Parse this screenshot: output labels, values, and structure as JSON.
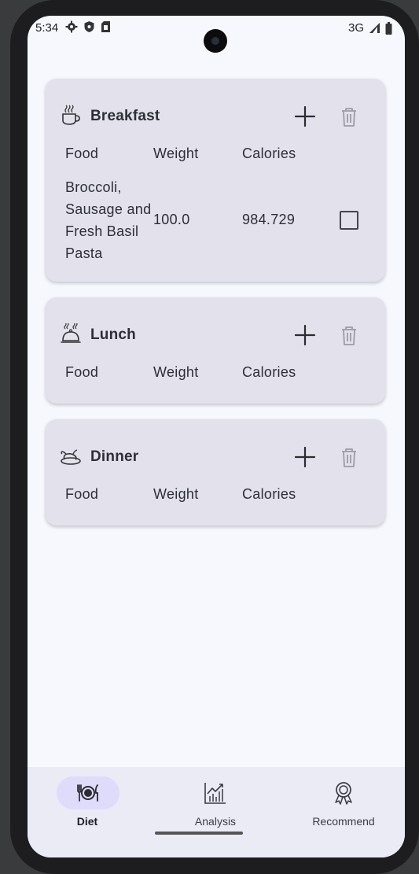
{
  "status_bar": {
    "time": "5:34",
    "network": "3G"
  },
  "columns": {
    "food": "Food",
    "weight": "Weight",
    "calories": "Calories"
  },
  "meals": [
    {
      "title": "Breakfast",
      "icon": "coffee-cup-icon",
      "rows": [
        {
          "food": "Broccoli, Sausage and Fresh Basil Pasta",
          "weight": "100.0",
          "calories": "984.729",
          "checked": false
        }
      ]
    },
    {
      "title": "Lunch",
      "icon": "food-cloche-icon",
      "rows": []
    },
    {
      "title": "Dinner",
      "icon": "roast-chicken-icon",
      "rows": []
    }
  ],
  "nav": {
    "items": [
      {
        "label": "Diet",
        "icon": "fork-plate-knife-icon",
        "active": true
      },
      {
        "label": "Analysis",
        "icon": "chart-icon",
        "active": false
      },
      {
        "label": "Recommend",
        "icon": "award-ribbon-icon",
        "active": false
      }
    ]
  },
  "colors": {
    "background": "#f7f8fe",
    "card": "#e3e2ec",
    "nav_background": "#ebebf6",
    "nav_active_pill": "#dedcfa",
    "delete_icon_disabled": "#9c9ba6"
  }
}
